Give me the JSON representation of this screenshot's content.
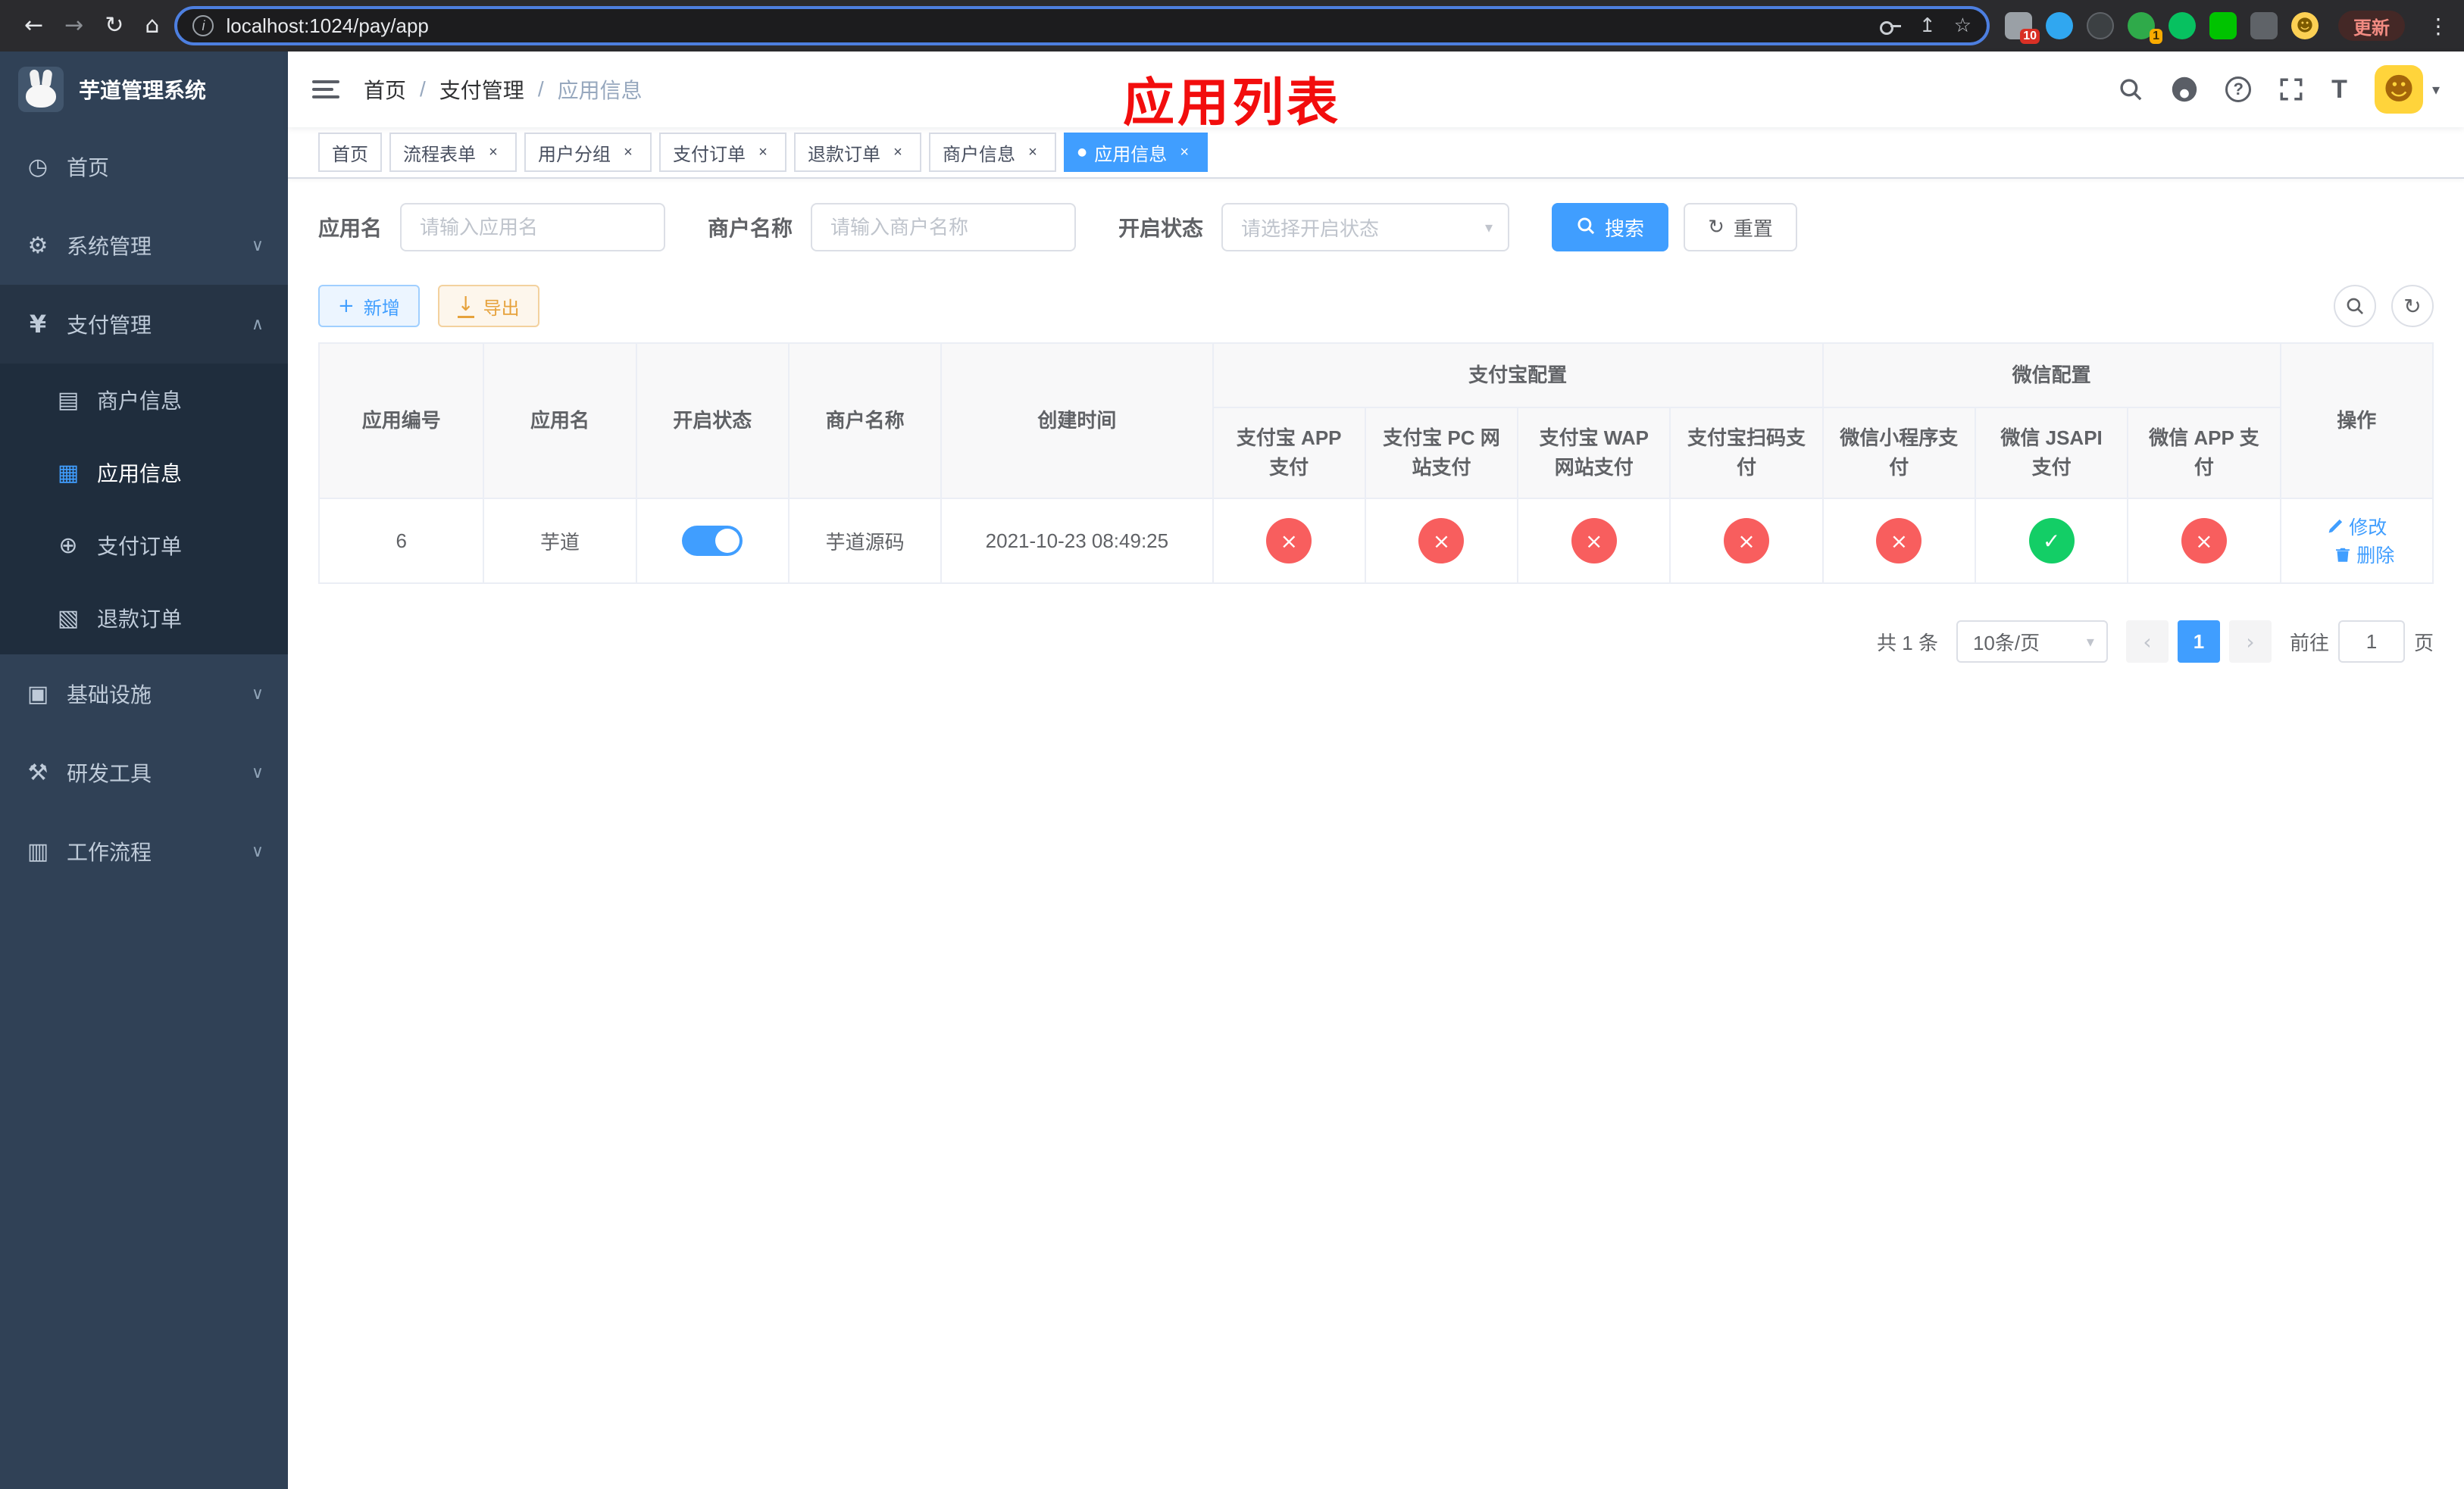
{
  "browser": {
    "url": "localhost:1024/pay/app",
    "update_label": "更新",
    "ext_badge_puzzle": "10",
    "ext_badge_avatar": "1"
  },
  "icons": {
    "back": "←",
    "forward": "→",
    "reload": "↻",
    "home": "⌂",
    "info": "i",
    "share": "↥",
    "star": "☆",
    "more": "⋮",
    "question": "?",
    "font_size": "T",
    "caret_down": "▾",
    "chevron_down": "∨",
    "chevron_up": "∧",
    "close": "×",
    "plus": "+",
    "download": "↓",
    "refresh": "↻",
    "dashboard": "◷",
    "gear": "⚙",
    "yen": "¥",
    "merchant": "▤",
    "app_grid": "▦",
    "pay_order": "⊕",
    "refund_order": "▧",
    "infra": "▣",
    "tools": "⚒",
    "workflow": "▥",
    "arrow_prev": "‹",
    "arrow_next": "›",
    "smiley": "☻",
    "check": "✓",
    "cross": "×",
    "dot": "●"
  },
  "sidebar": {
    "title": "芋道管理系统",
    "items": {
      "home": "首页",
      "system": "系统管理",
      "payment": "支付管理",
      "merchant_info": "商户信息",
      "app_info": "应用信息",
      "pay_order": "支付订单",
      "refund_order": "退款订单",
      "infra": "基础设施",
      "dev_tools": "研发工具",
      "workflow": "工作流程"
    }
  },
  "breadcrumb": {
    "items": [
      "首页",
      "支付管理",
      "应用信息"
    ],
    "separator": "/"
  },
  "page": {
    "overlay_title": "应用列表"
  },
  "tabs": {
    "items": [
      {
        "label": "首页"
      },
      {
        "label": "流程表单"
      },
      {
        "label": "用户分组"
      },
      {
        "label": "支付订单"
      },
      {
        "label": "退款订单"
      },
      {
        "label": "商户信息"
      },
      {
        "label": "应用信息"
      }
    ]
  },
  "filters": {
    "app_name": {
      "label": "应用名",
      "placeholder": "请输入应用名"
    },
    "merchant_name": {
      "label": "商户名称",
      "placeholder": "请输入商户名称"
    },
    "status": {
      "label": "开启状态",
      "placeholder": "请选择开启状态"
    },
    "search_label": "搜索",
    "reset_label": "重置"
  },
  "toolbar": {
    "add_label": "新增",
    "export_label": "导出"
  },
  "table": {
    "group_alipay": "支付宝配置",
    "group_wechat": "微信配置",
    "col_id": "应用编号",
    "col_name": "应用名",
    "col_status": "开启状态",
    "col_merchant": "商户名称",
    "col_created": "创建时间",
    "col_alipay_app": "支付宝 APP 支付",
    "col_alipay_pc": "支付宝 PC 网站支付",
    "col_alipay_wap": "支付宝 WAP 网站支付",
    "col_alipay_qr": "支付宝扫码支付",
    "col_wx_mini": "微信小程序支付",
    "col_wx_jsapi": "微信 JSAPI 支付",
    "col_wx_app": "微信 APP 支付",
    "col_actions": "操作",
    "row": {
      "id": "6",
      "name": "芋道",
      "enabled": true,
      "merchant": "芋道源码",
      "created": "2021-10-23 08:49:25",
      "channels": [
        false,
        false,
        false,
        false,
        false,
        true,
        false
      ],
      "edit_label": "修改",
      "delete_label": "删除"
    }
  },
  "pagination": {
    "total": "共 1 条",
    "page_size": "10条/页",
    "page": "1",
    "goto_label": "前往",
    "goto_value": "1",
    "unit_label": "页"
  }
}
